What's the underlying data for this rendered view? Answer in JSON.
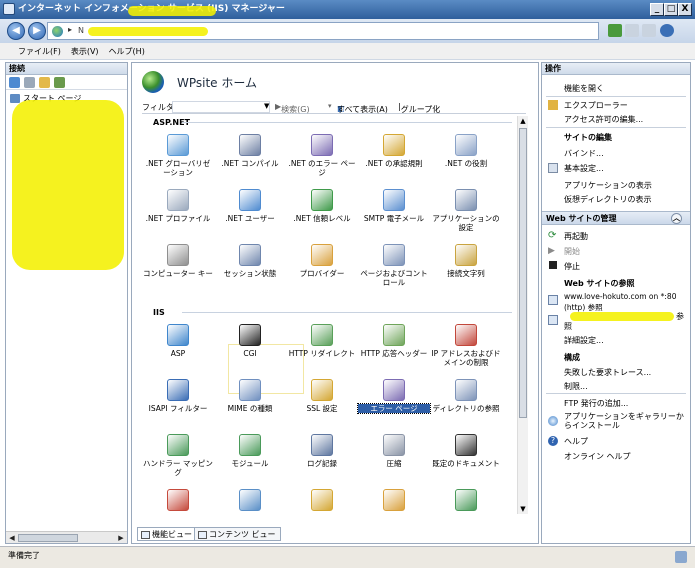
{
  "window": {
    "title": "インターネット インフォメーション サービス (IIS) マネージャー",
    "buttons": [
      "_",
      "□",
      "X"
    ]
  },
  "address": {
    "separator": "▸",
    "path_visible": "N"
  },
  "menu": {
    "items": [
      "ファイル(F)",
      "表示(V)",
      "ヘルプ(H)"
    ]
  },
  "connections": {
    "header": "接続",
    "tree": [
      "スタート ページ"
    ]
  },
  "center": {
    "title": "WPsite ホーム",
    "filter_label": "フィルター:",
    "search_label": "検索(G)",
    "show_all_label": "すべて表示(A)",
    "group_label": "グループ化",
    "sections": [
      {
        "name": "ASP.NET",
        "features": [
          {
            "label": ".NET グローバリゼーション",
            "icon": "globe-doc-icon"
          },
          {
            "label": ".NET コンパイル",
            "icon": "compile-icon"
          },
          {
            "label": ".NET のエラー ページ",
            "icon": "error-page-icon"
          },
          {
            "label": ".NET の承認規則",
            "icon": "lock-icon"
          },
          {
            "label": ".NET の役割",
            "icon": "role-icon"
          },
          {
            "label": ".NET プロファイル",
            "icon": "profile-icon"
          },
          {
            "label": ".NET ユーザー",
            "icon": "users-icon"
          },
          {
            "label": ".NET 信頼レベル",
            "icon": "trust-icon"
          },
          {
            "label": "SMTP 電子メール",
            "icon": "mail-icon"
          },
          {
            "label": "アプリケーションの設定",
            "icon": "app-settings-icon"
          },
          {
            "label": "コンピューター キー",
            "icon": "machine-key-icon"
          },
          {
            "label": "セッション状態",
            "icon": "session-icon"
          },
          {
            "label": "プロバイダー",
            "icon": "provider-icon"
          },
          {
            "label": "ページおよびコントロール",
            "icon": "pages-icon"
          },
          {
            "label": "接続文字列",
            "icon": "connstring-icon"
          }
        ]
      },
      {
        "name": "IIS",
        "features": [
          {
            "label": "ASP",
            "icon": "asp-icon"
          },
          {
            "label": "CGI",
            "icon": "cgi-icon"
          },
          {
            "label": "HTTP リダイレクト",
            "icon": "redirect-icon"
          },
          {
            "label": "HTTP 応答ヘッダー",
            "icon": "headers-icon"
          },
          {
            "label": "IP アドレスおよびドメインの制限",
            "icon": "ip-restrict-icon"
          },
          {
            "label": "ISAPI フィルター",
            "icon": "isapi-icon"
          },
          {
            "label": "MIME の種類",
            "icon": "mime-icon"
          },
          {
            "label": "SSL 設定",
            "icon": "ssl-lock-icon"
          },
          {
            "label": "エラー ページ",
            "icon": "error-page-icon",
            "selected": true
          },
          {
            "label": "ディレクトリの参照",
            "icon": "dir-browse-icon"
          },
          {
            "label": "ハンドラー マッピング",
            "icon": "handler-icon"
          },
          {
            "label": "モジュール",
            "icon": "module-icon"
          },
          {
            "label": "ログ記録",
            "icon": "log-icon"
          },
          {
            "label": "圧縮",
            "icon": "compress-icon"
          },
          {
            "label": "既定のドキュメント",
            "icon": "default-doc-icon"
          },
          {
            "label": "",
            "icon": "auth-icon"
          },
          {
            "label": "",
            "icon": "output-cache-icon"
          },
          {
            "label": "",
            "icon": "lock2-icon"
          },
          {
            "label": "",
            "icon": "user-icon"
          },
          {
            "label": "",
            "icon": "request-filter-icon"
          }
        ]
      }
    ],
    "tabs": [
      "機能ビュー",
      "コンテンツ ビュー"
    ]
  },
  "actions": {
    "header": "操作",
    "open_feature": "機能を開く",
    "explore": "エクスプローラー",
    "edit_permissions": "アクセス許可の編集...",
    "edit_site_head": "サイトの編集",
    "bindings": "バインド...",
    "basic_settings": "基本設定...",
    "view_apps": "アプリケーションの表示",
    "view_vdirs": "仮想ディレクトリの表示",
    "manage_site_header": "Web サイトの管理",
    "restart": "再起動",
    "start": "開始",
    "stop": "停止",
    "browse_head": "Web サイトの参照",
    "browse_link_1": "www.love-hokuto.com on *:80",
    "browse_link_1b": "(http) 参照",
    "browse_link_2_tail": "参",
    "browse_link_2b": "照",
    "advanced_settings": "詳細設定...",
    "configure_head": "構成",
    "failed_tracing": "失敗した要求トレース...",
    "limits": "制限...",
    "ftp_publish": "FTP 発行の追加...",
    "gallery_install": "アプリケーションをギャラリーからインストール",
    "help": "ヘルプ",
    "online_help": "オンライン ヘルプ"
  },
  "status": {
    "text": "準備完了"
  },
  "colors": {
    "titlebar": "#2f5f9c",
    "selection": "#2f5fa8",
    "highlight": "#f4f000"
  }
}
